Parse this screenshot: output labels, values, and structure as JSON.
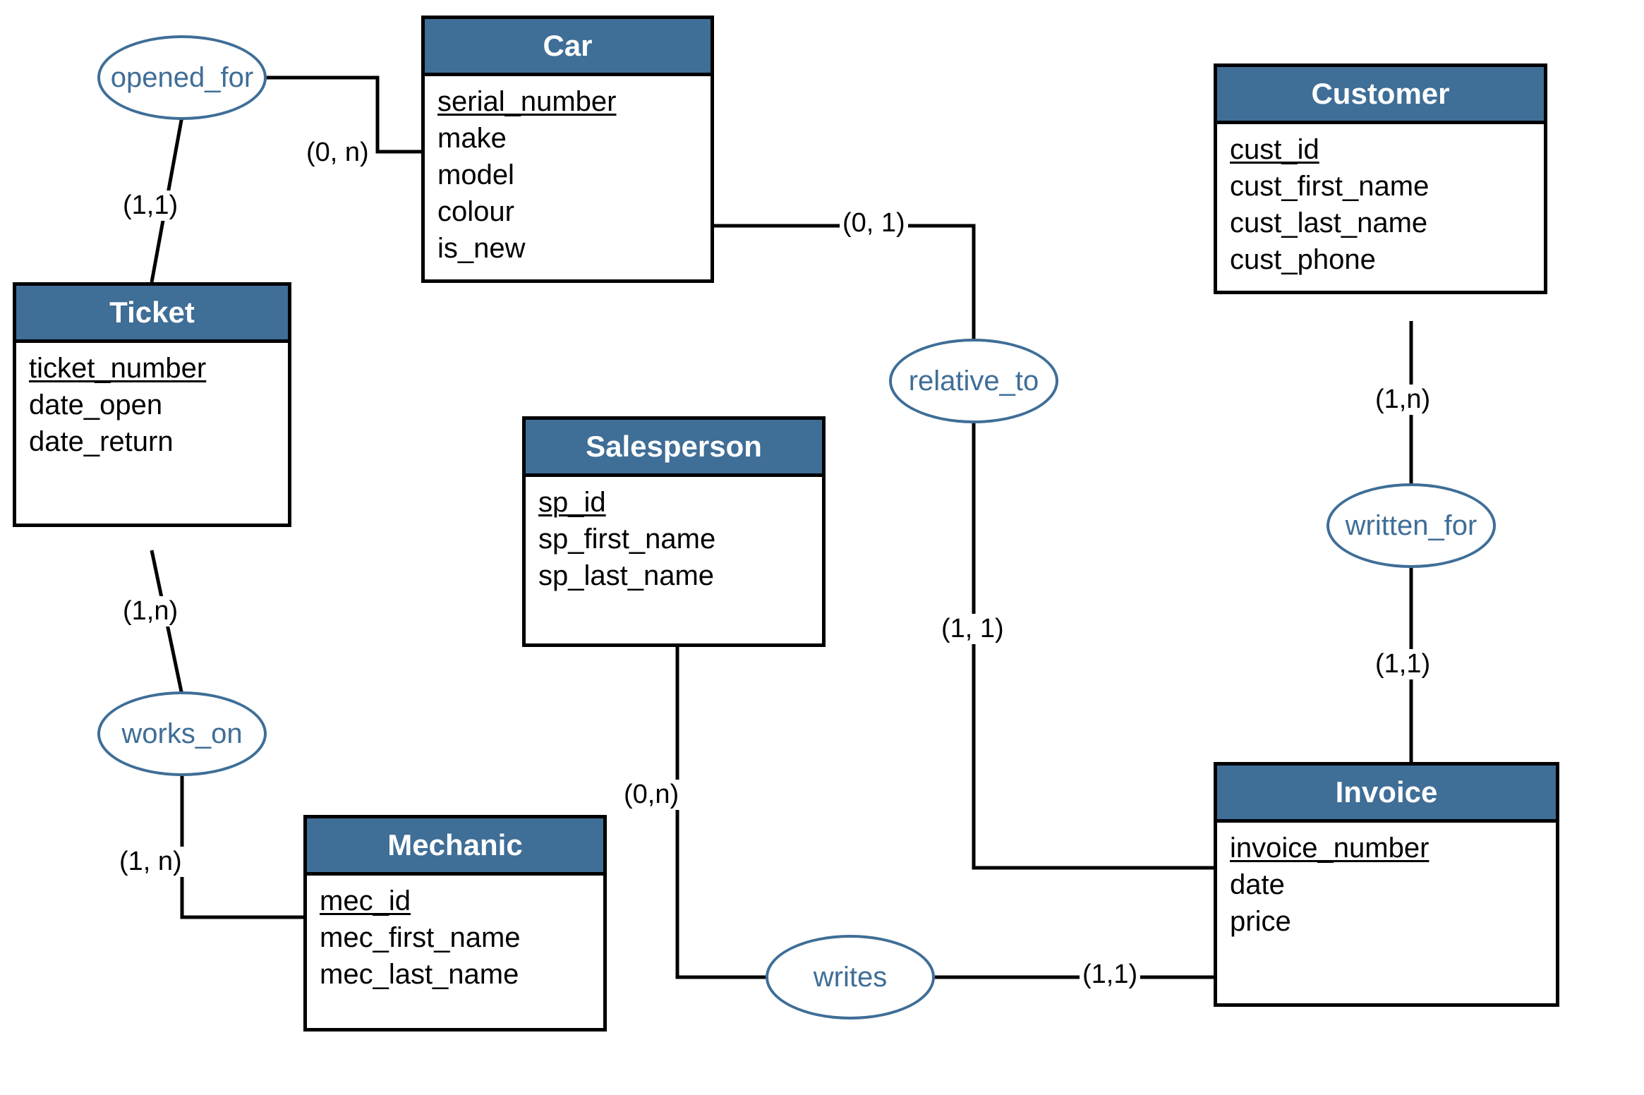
{
  "colors": {
    "header": "#3F6E97",
    "border": "#000000",
    "relation": "#3F6E97"
  },
  "entities": {
    "car": {
      "name": "Car",
      "attributes": [
        {
          "name": "serial_number",
          "key": true
        },
        {
          "name": "make"
        },
        {
          "name": "model"
        },
        {
          "name": "colour"
        },
        {
          "name": "is_new"
        }
      ]
    },
    "customer": {
      "name": "Customer",
      "attributes": [
        {
          "name": "cust_id",
          "key": true
        },
        {
          "name": "cust_first_name"
        },
        {
          "name": "cust_last_name"
        },
        {
          "name": "cust_phone"
        }
      ]
    },
    "ticket": {
      "name": "Ticket",
      "attributes": [
        {
          "name": "ticket_number",
          "key": true
        },
        {
          "name": "date_open"
        },
        {
          "name": "date_return"
        }
      ]
    },
    "salesperson": {
      "name": "Salesperson",
      "attributes": [
        {
          "name": "sp_id",
          "key": true
        },
        {
          "name": "sp_first_name"
        },
        {
          "name": "sp_last_name"
        }
      ]
    },
    "mechanic": {
      "name": "Mechanic",
      "attributes": [
        {
          "name": "mec_id",
          "key": true
        },
        {
          "name": "mec_first_name"
        },
        {
          "name": "mec_last_name"
        }
      ]
    },
    "invoice": {
      "name": "Invoice",
      "attributes": [
        {
          "name": "invoice_number",
          "key": true
        },
        {
          "name": "date"
        },
        {
          "name": "price"
        }
      ]
    }
  },
  "relations": {
    "opened_for": {
      "label": "opened_for",
      "sides": {
        "ticket": {
          "cardinality": "(1,1)"
        },
        "car": {
          "cardinality": "(0, n)"
        }
      }
    },
    "works_on": {
      "label": "works_on",
      "sides": {
        "ticket": {
          "cardinality": "(1,n)"
        },
        "mechanic": {
          "cardinality": "(1, n)"
        }
      }
    },
    "relative_to": {
      "label": "relative_to",
      "sides": {
        "car": {
          "cardinality": "(0, 1)"
        },
        "invoice": {
          "cardinality": "(1, 1)"
        }
      }
    },
    "writes": {
      "label": "writes",
      "sides": {
        "salesperson": {
          "cardinality": "(0,n)"
        },
        "invoice": {
          "cardinality": "(1,1)"
        }
      }
    },
    "written_for": {
      "label": "written_for",
      "sides": {
        "customer": {
          "cardinality": "(1,n)"
        },
        "invoice": {
          "cardinality": "(1,1)"
        }
      }
    }
  }
}
